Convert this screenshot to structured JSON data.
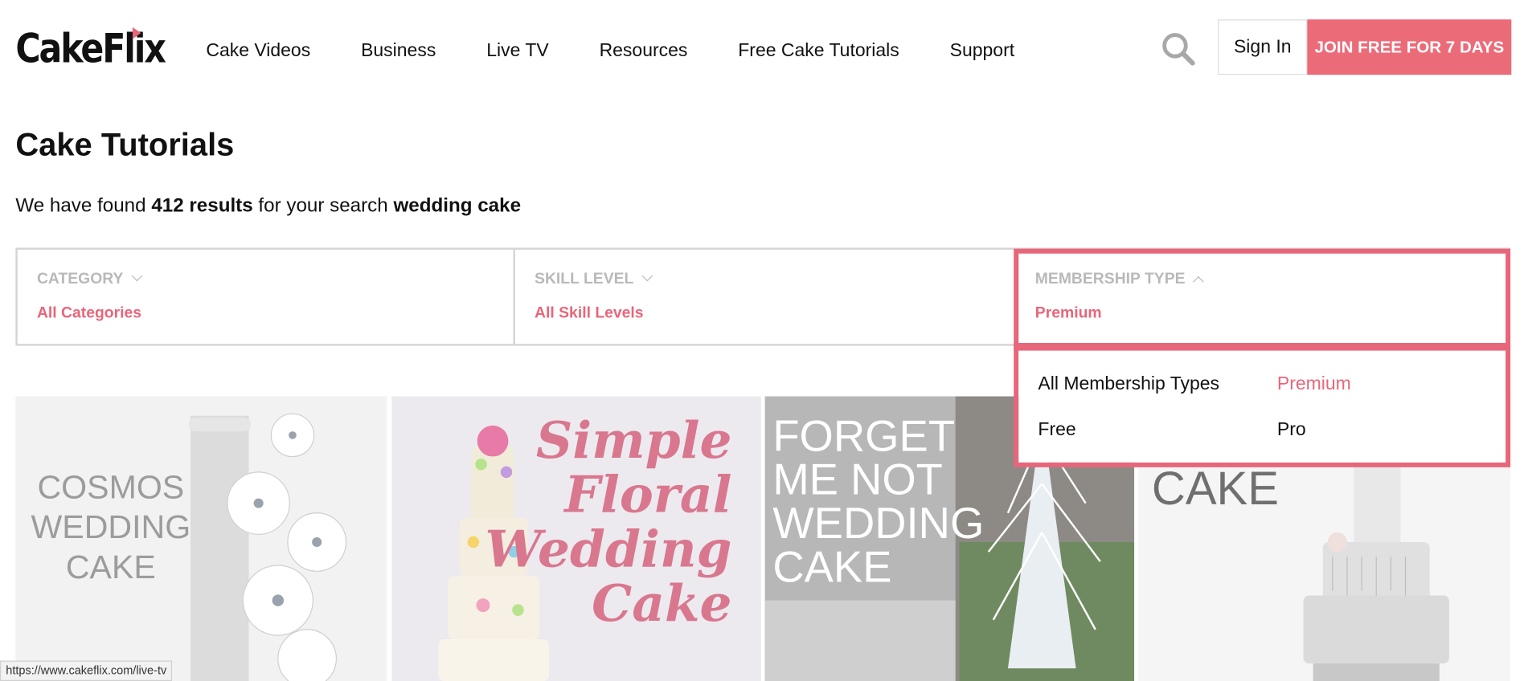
{
  "brand": {
    "logo": "CakeFlix",
    "accent": "#e8667a"
  },
  "nav": {
    "items": [
      {
        "label": "Cake Videos"
      },
      {
        "label": "Business"
      },
      {
        "label": "Live TV"
      },
      {
        "label": "Resources"
      },
      {
        "label": "Free Cake Tutorials"
      },
      {
        "label": "Support"
      }
    ]
  },
  "header": {
    "search_icon": "search-icon",
    "signin_label": "Sign In",
    "join_label": "JOIN FREE FOR 7 DAYS"
  },
  "main": {
    "title": "Cake Tutorials",
    "results": {
      "prefix": "We have found ",
      "count": "412 results",
      "middle": " for your search ",
      "query": "wedding cake"
    }
  },
  "filters": {
    "category": {
      "label": "CATEGORY",
      "value": "All Categories"
    },
    "skill": {
      "label": "SKILL LEVEL",
      "value": "All Skill Levels"
    },
    "membership": {
      "label": "MEMBERSHIP TYPE",
      "value": "Premium",
      "options": [
        "All Membership Types",
        "Premium",
        "Free",
        "Pro"
      ],
      "selected": "Premium"
    }
  },
  "thumbnails": [
    {
      "text": "COSMOS\nWEDDING\nCAKE"
    },
    {
      "text": "Simple\nFloral\nWedding\nCake"
    },
    {
      "text": "FORGET\nME NOT\nWEDDING\nCAKE"
    },
    {
      "text": "CAKE"
    }
  ],
  "status_url": "https://www.cakeflix.com/live-tv"
}
